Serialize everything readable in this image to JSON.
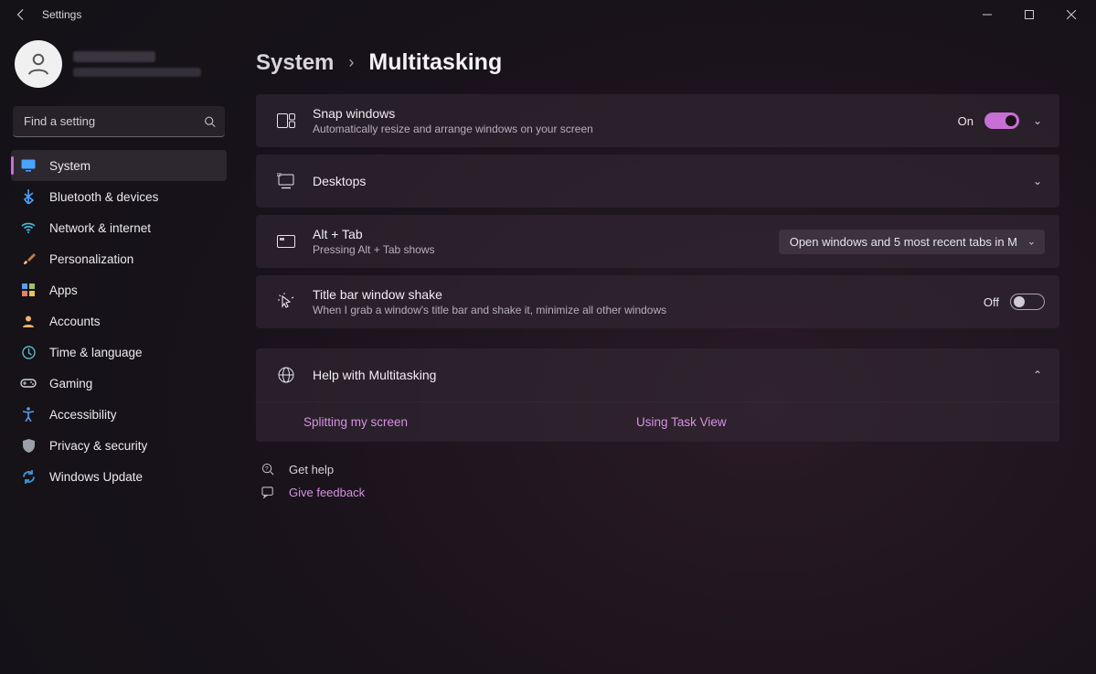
{
  "window": {
    "title": "Settings"
  },
  "search": {
    "placeholder": "Find a setting"
  },
  "sidebar": {
    "items": [
      {
        "label": "System",
        "icon": "display-icon",
        "color": "#4aa3ff",
        "active": true
      },
      {
        "label": "Bluetooth & devices",
        "icon": "bluetooth-icon",
        "color": "#4aa3ff"
      },
      {
        "label": "Network & internet",
        "icon": "wifi-icon",
        "color": "#3fbde0"
      },
      {
        "label": "Personalization",
        "icon": "brush-icon",
        "color": "#e08a5b"
      },
      {
        "label": "Apps",
        "icon": "apps-icon",
        "color": "#5aa0e8"
      },
      {
        "label": "Accounts",
        "icon": "person-icon",
        "color": "#f1b56a"
      },
      {
        "label": "Time & language",
        "icon": "clock-globe-icon",
        "color": "#5bb6c8"
      },
      {
        "label": "Gaming",
        "icon": "gamepad-icon",
        "color": "#cfd4da"
      },
      {
        "label": "Accessibility",
        "icon": "accessibility-icon",
        "color": "#5aa0e8"
      },
      {
        "label": "Privacy & security",
        "icon": "shield-icon",
        "color": "#9aa0a8"
      },
      {
        "label": "Windows Update",
        "icon": "update-icon",
        "color": "#3b98dd"
      }
    ]
  },
  "breadcrumb": {
    "parent": "System",
    "current": "Multitasking"
  },
  "settings": {
    "snap": {
      "title": "Snap windows",
      "subtitle": "Automatically resize and arrange windows on your screen",
      "state": "On",
      "on": true
    },
    "desktops": {
      "title": "Desktops"
    },
    "altTab": {
      "title": "Alt + Tab",
      "subtitle": "Pressing Alt + Tab shows",
      "selected": "Open windows and 5 most recent tabs in M"
    },
    "shake": {
      "title": "Title bar window shake",
      "subtitle": "When I grab a window's title bar and shake it, minimize all other windows",
      "state": "Off",
      "on": false
    }
  },
  "help": {
    "title": "Help with Multitasking",
    "links": [
      "Splitting my screen",
      "Using Task View"
    ]
  },
  "footer": {
    "getHelp": "Get help",
    "giveFeedback": "Give feedback"
  }
}
